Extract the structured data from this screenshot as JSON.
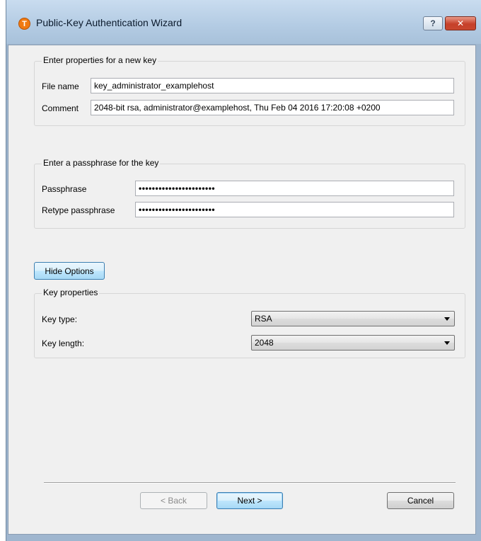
{
  "window": {
    "title": "Public-Key Authentication Wizard",
    "icon_letter": "T",
    "help_glyph": "?",
    "close_glyph": "✕"
  },
  "new_key": {
    "group_title": "Enter properties for a new key",
    "file_name_label": "File name",
    "file_name_value": "key_administrator_examplehost",
    "comment_label": "Comment",
    "comment_value": "2048-bit rsa, administrator@examplehost, Thu Feb 04 2016 17:20:08 +0200"
  },
  "passphrase": {
    "group_title": "Enter a passphrase for the key",
    "passphrase_label": "Passphrase",
    "passphrase_value": "•••••••••••••••••••••••",
    "retype_label": "Retype passphrase",
    "retype_value": "•••••••••••••••••••••••"
  },
  "options_button_label": "Hide Options",
  "key_properties": {
    "group_title": "Key properties",
    "key_type_label": "Key type:",
    "key_type_value": "RSA",
    "key_length_label": "Key length:",
    "key_length_value": "2048"
  },
  "footer": {
    "back_label": "< Back",
    "next_label": "Next >",
    "cancel_label": "Cancel"
  }
}
